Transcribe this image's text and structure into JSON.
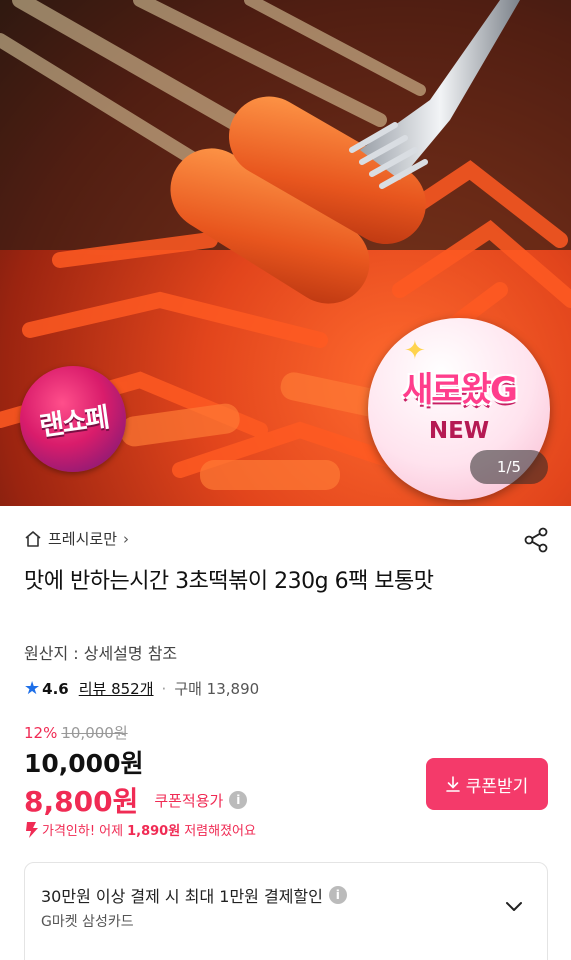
{
  "gallery": {
    "counter": "1/5",
    "badge_left": "랜쇼페",
    "badge_right_title": "새로왔G",
    "badge_right_sub": "NEW"
  },
  "breadcrumb": {
    "label": "프레시로만",
    "icon": "home-icon"
  },
  "product": {
    "title": "맛에 반하는시간 3초떡볶이 230g 6팩 보통맛",
    "origin": "원산지 : 상세설명 참조",
    "rating": "4.6",
    "reviews": "리뷰 852개",
    "separator": "·",
    "purchases": "구매 13,890"
  },
  "pricing": {
    "discount_rate": "12%",
    "original_price": "10,000원",
    "price": "10,000원",
    "coupon_price": "8,800원",
    "coupon_label": "쿠폰적용가",
    "drop_prefix": "가격인하! 어제",
    "drop_amount": "1,890원",
    "drop_suffix": "저렴해졌어요"
  },
  "coupon_button": {
    "label": "쿠폰받기"
  },
  "card_offer": {
    "line1": "30만원 이상 결제 시 최대 1만원 결제할인",
    "line2": "G마켓 삼성카드"
  },
  "colors": {
    "accent": "#f02b54",
    "button": "#f43a6a",
    "star": "#1e6fe8"
  }
}
